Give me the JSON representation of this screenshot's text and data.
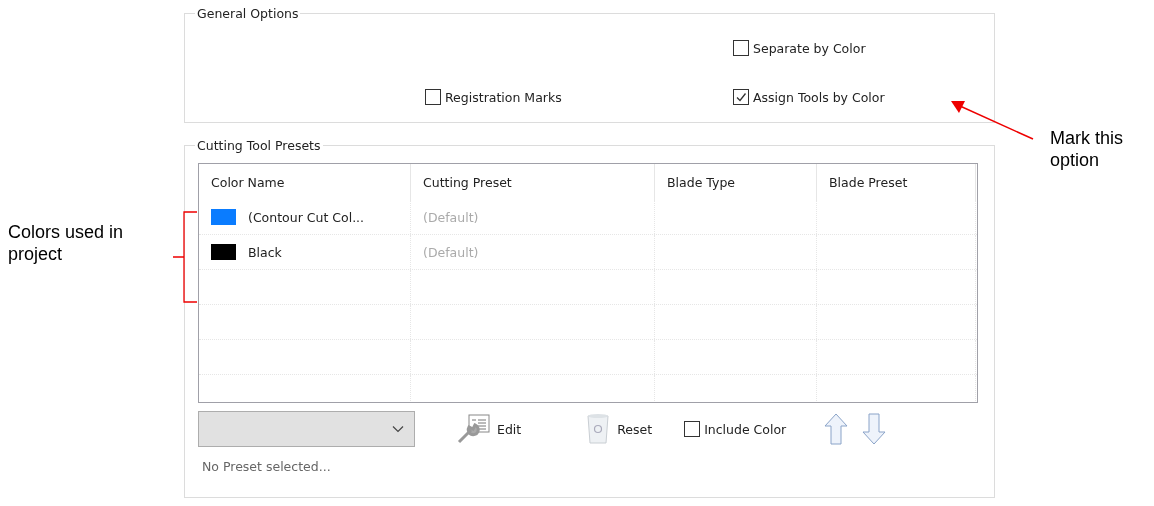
{
  "general_options": {
    "title": "General Options",
    "checkboxes": [
      {
        "label": "Separate by Color",
        "checked": false
      },
      {
        "label": "Registration Marks",
        "checked": false
      },
      {
        "label": "Assign Tools by Color",
        "checked": true
      }
    ]
  },
  "cutting_tool_presets": {
    "title": "Cutting Tool Presets",
    "table": {
      "columns": [
        "Color Name",
        "Cutting Preset",
        "Blade Type",
        "Blade Preset"
      ],
      "rows": [
        {
          "color": "#0a7cff",
          "color_name": "(Contour Cut Col...",
          "cutting_preset": "(Default)"
        },
        {
          "color": "#000000",
          "color_name": "Black",
          "cutting_preset": "(Default)"
        }
      ]
    },
    "buttons": [
      {
        "kind": "edit",
        "label": "Edit"
      },
      {
        "kind": "reset",
        "label": "Reset"
      }
    ],
    "include_color": {
      "label": "Include Color",
      "checked": false
    },
    "status": "No Preset selected..."
  },
  "annotations": [
    {
      "kind": "bracket",
      "text": "Colors used in project"
    },
    {
      "kind": "arrow",
      "text": "Mark this option"
    }
  ]
}
